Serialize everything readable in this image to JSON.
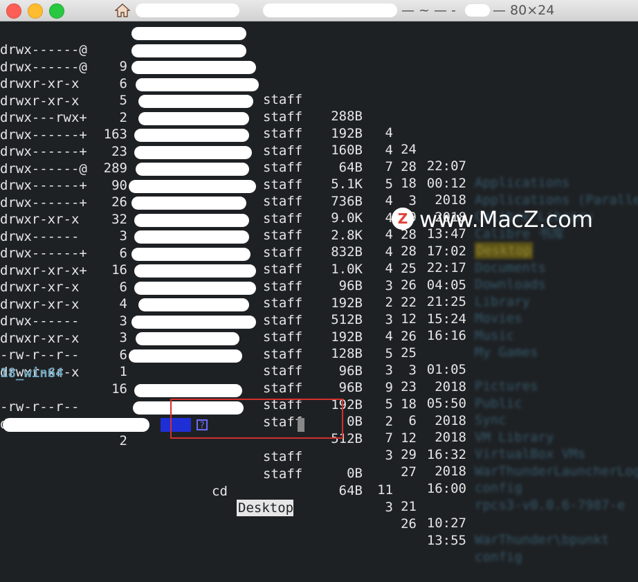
{
  "window": {
    "title_suffix": "— ~ — -",
    "title_size": "— 80×24"
  },
  "listing": [
    {
      "perm": "drwx------@",
      "links": "9",
      "group": "staff",
      "size": "288B",
      "month": "4",
      "day": "24",
      "time": "22:07",
      "name": "Applications"
    },
    {
      "perm": "drwx------@",
      "links": "6",
      "group": "staff",
      "size": "192B",
      "month": "4",
      "day": "28",
      "time": "00:12",
      "name": "Applications (Parallels)"
    },
    {
      "perm": "drwxr-xr-x",
      "links": "5",
      "group": "staff",
      "size": "160B",
      "month": "7",
      "day": "18",
      "time": "2018",
      "name": "Calibre Library"
    },
    {
      "perm": "drwxr-xr-x",
      "links": "2",
      "group": "staff",
      "size": "64B",
      "month": "5",
      "day": "3",
      "time": "2018",
      "name": "Calibre 书库"
    },
    {
      "perm": "drwx---rwx+",
      "links": "163",
      "group": "staff",
      "size": "5.1K",
      "month": "4",
      "day": "29",
      "time": "13:47",
      "name": "Desktop",
      "highlight": true
    },
    {
      "perm": "drwx------+",
      "links": "23",
      "group": "staff",
      "size": "736B",
      "month": "4",
      "day": "28",
      "time": "17:02",
      "name": "Documents"
    },
    {
      "perm": "drwx------+",
      "links": "289",
      "group": "staff",
      "size": "9.0K",
      "month": "4",
      "day": "28",
      "time": "22:17",
      "name": "Downloads"
    },
    {
      "perm": "drwx------@",
      "links": "90",
      "group": "staff",
      "size": "2.8K",
      "month": "4",
      "day": "25",
      "time": "04:05",
      "name": "Library"
    },
    {
      "perm": "drwx------+",
      "links": "26",
      "group": "staff",
      "size": "832B",
      "month": "4",
      "day": "26",
      "time": "21:25",
      "name": "Movies"
    },
    {
      "perm": "drwx------+",
      "links": "32",
      "group": "staff",
      "size": "1.0K",
      "month": "3",
      "day": "22",
      "time": "15:24",
      "name": "Music"
    },
    {
      "perm": "drwxr-xr-x",
      "links": "3",
      "group": "staff",
      "size": "96B",
      "month": "2",
      "day": "12",
      "time": "16:16",
      "name": "My Games"
    },
    {
      "perm": "drwx------",
      "links": "6",
      "group": "staff",
      "size": "192B",
      "month": "3",
      "day": "26",
      "time": "",
      "name": ""
    },
    {
      "perm": "drwx------+",
      "links": "16",
      "group": "staff",
      "size": "512B",
      "month": "4",
      "day": "25",
      "time": "01:05",
      "name": "Pictures"
    },
    {
      "perm": "drwxr-xr-x+",
      "links": "6",
      "group": "staff",
      "size": "192B",
      "month": "5",
      "day": "3",
      "time": "2018",
      "name": "Public"
    },
    {
      "perm": "drwxr-xr-x",
      "links": "4",
      "group": "staff",
      "size": "128B",
      "month": "3",
      "day": "23",
      "time": "05:50",
      "name": "Sync"
    },
    {
      "perm": "drwxr-xr-x",
      "links": "3",
      "group": "staff",
      "size": "96B",
      "month": "9",
      "day": "18",
      "time": "2018",
      "name": "VM Library"
    },
    {
      "perm": "drwx------",
      "links": "3",
      "group": "staff",
      "size": "96B",
      "month": "5",
      "day": "6",
      "time": "2018",
      "name": "VirtualBox VMs"
    },
    {
      "perm": "drwxr-xr-x",
      "links": "6",
      "group": "staff",
      "size": "192B",
      "month": "2",
      "day": "12",
      "time": "16:32",
      "name": "WarThunderLauncherLogs"
    },
    {
      "perm": "-rw-r--r--",
      "links": "1",
      "group": "staff",
      "size": "0B",
      "month": "7",
      "day": "29",
      "time": "2018",
      "name": "config"
    },
    {
      "perm": "drwxr-xr-x",
      "links": "16",
      "group": "staff",
      "size": "512B",
      "month": "3",
      "day": "27",
      "time": "16:00",
      "name": "rpcs3-v0.0.6-7987-e"
    }
  ],
  "dir_header": "18_win64",
  "listing2": [
    {
      "perm": "-rw-r--r--",
      "links": "1",
      "group": "staff",
      "size": "0B",
      "month": "11",
      "day": "21",
      "time": "10:27",
      "name": "WarThunder\\bpunkt"
    },
    {
      "perm": "drwxr-xr-x",
      "links": "2",
      "group": "staff",
      "size": "64B",
      "month": "3",
      "day": "26",
      "time": "13:55",
      "name": "config"
    }
  ],
  "prompt": {
    "symbol": "?",
    "command": "cd",
    "argument": "Desktop"
  },
  "watermark": {
    "logo_letter": "Z",
    "text": "www.MacZ.com"
  },
  "colors": {
    "terminal_bg": "#1e2124",
    "text": "#e6e6e6",
    "dir_name": "#3f6f86",
    "callout": "#d4302c"
  }
}
